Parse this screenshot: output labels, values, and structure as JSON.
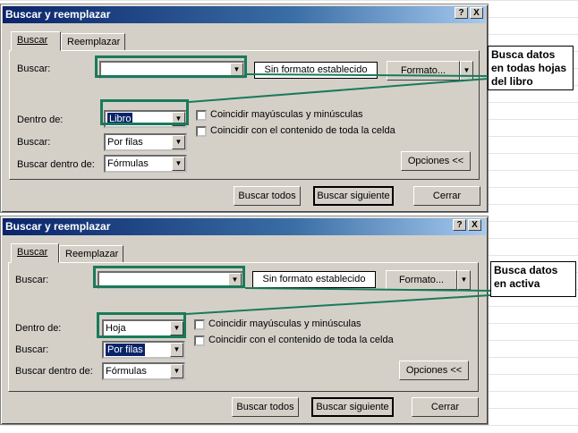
{
  "dialog1": {
    "title": "Buscar y reemplazar",
    "help_btn": "?",
    "close_btn": "X",
    "tab_buscar": "Buscar",
    "tab_reemplazar": "Reemplazar",
    "buscar_label": "Buscar:",
    "buscar_value": "",
    "format_status": "Sin formato establecido",
    "format_button": "Formato...",
    "dentro_label": "Dentro de:",
    "dentro_value": "Libro",
    "buscar2_label": "Buscar:",
    "buscar2_value": "Por filas",
    "buscar_dentro_label": "Buscar dentro de:",
    "buscar_dentro_value": "Fórmulas",
    "check_mayusculas": "Coincidir mayúsculas y minúsculas",
    "check_celda": "Coincidir con el contenido de toda la celda",
    "opciones_button": "Opciones <<",
    "buscar_todos": "Buscar todos",
    "buscar_siguiente": "Buscar siguiente",
    "cerrar": "Cerrar"
  },
  "dialog2": {
    "title": "Buscar y reemplazar",
    "help_btn": "?",
    "close_btn": "X",
    "tab_buscar": "Buscar",
    "tab_reemplazar": "Reemplazar",
    "buscar_label": "Buscar:",
    "buscar_value": "",
    "format_status": "Sin formato establecido",
    "format_button": "Formato...",
    "dentro_label": "Dentro de:",
    "dentro_value": "Hoja",
    "buscar2_label": "Buscar:",
    "buscar2_value": "Por filas",
    "buscar_dentro_label": "Buscar dentro de:",
    "buscar_dentro_value": "Fórmulas",
    "check_mayusculas": "Coincidir mayúsculas y minúsculas",
    "check_celda": "Coincidir con el contenido de toda la celda",
    "opciones_button": "Opciones <<",
    "buscar_todos": "Buscar todos",
    "buscar_siguiente": "Buscar siguiente",
    "cerrar": "Cerrar"
  },
  "callouts": {
    "top": "Busca datos en todas hojas del libro",
    "bottom": "Busca datos en activa"
  },
  "colors": {
    "highlight": "#1a7a5a",
    "title_start": "#0a246a",
    "dialog_bg": "#d4d0c8"
  }
}
